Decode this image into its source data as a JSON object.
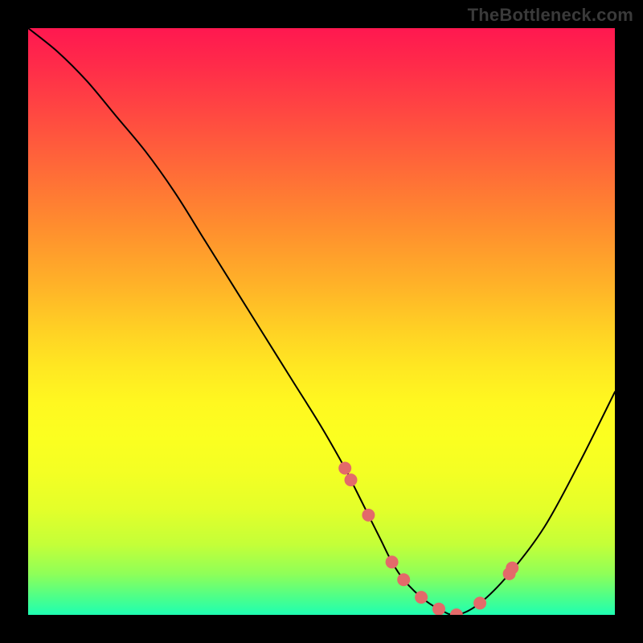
{
  "watermark": "TheBottleneck.com",
  "chart_data": {
    "type": "line",
    "title": "",
    "xlabel": "",
    "ylabel": "",
    "xlim": [
      0,
      100
    ],
    "ylim": [
      0,
      100
    ],
    "grid": false,
    "legend": false,
    "series": [
      {
        "name": "bottleneck-curve",
        "x": [
          0,
          5,
          10,
          15,
          20,
          25,
          30,
          35,
          40,
          45,
          50,
          54,
          55,
          58,
          60,
          62,
          64,
          67,
          70,
          73,
          77,
          82,
          88,
          94,
          100
        ],
        "y": [
          100,
          96,
          91,
          85,
          79,
          72,
          64,
          56,
          48,
          40,
          32,
          25,
          23,
          17,
          13,
          9,
          6,
          3,
          1,
          0,
          2,
          7,
          15,
          26,
          38
        ]
      }
    ],
    "markers": {
      "name": "highlight-points",
      "color": "#e36a6a",
      "radius_px": 8,
      "x": [
        54,
        55,
        58,
        62,
        64,
        67,
        70,
        73,
        77,
        82,
        82.5
      ],
      "y": [
        25,
        23,
        17,
        9,
        6,
        3,
        1,
        0,
        2,
        7,
        8
      ]
    },
    "background_gradient": {
      "direction": "top-to-bottom",
      "stops": [
        "#ff1850",
        "#ffe822",
        "#1fffb2"
      ]
    }
  }
}
